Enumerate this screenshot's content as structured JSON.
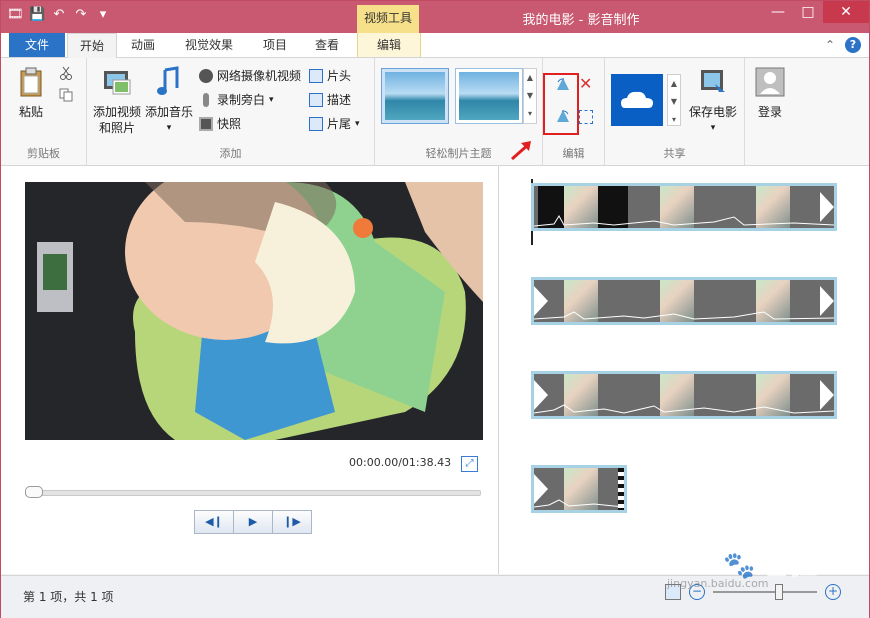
{
  "titlebar": {
    "context_tab_title": "视频工具",
    "window_title": "我的电影 - 影音制作",
    "min": "—",
    "max": "□",
    "close": "✕"
  },
  "tabs": {
    "file": "文件",
    "home": "开始",
    "animations": "动画",
    "visual_effects": "视觉效果",
    "project": "项目",
    "view": "查看",
    "edit": "编辑"
  },
  "ribbon": {
    "clipboard": {
      "paste": "粘贴",
      "group": "剪贴板"
    },
    "add": {
      "add_videos_line1": "添加视频",
      "add_videos_line2": "和照片",
      "add_music": "添加音乐",
      "webcam": "网络摄像机视频",
      "narration": "录制旁白",
      "snapshot": "快照",
      "title": "片头",
      "caption": "描述",
      "credits": "片尾",
      "group": "添加"
    },
    "themes": {
      "group": "轻松制片主题"
    },
    "editing": {
      "group": "编辑"
    },
    "share": {
      "save_movie": "保存电影",
      "group": "共享"
    },
    "signin": {
      "label": "登录"
    }
  },
  "player": {
    "time": "00:00.00/01:38.43"
  },
  "statusbar": {
    "text": "第 1 项，共 1 项"
  },
  "watermark": {
    "brand": "Bai",
    "brand_tail": "经验",
    "url": "jingyan.baidu.com"
  },
  "colors": {
    "accent": "#2b73c6",
    "titlebar": "#c85970",
    "highlight": "#e02020"
  }
}
